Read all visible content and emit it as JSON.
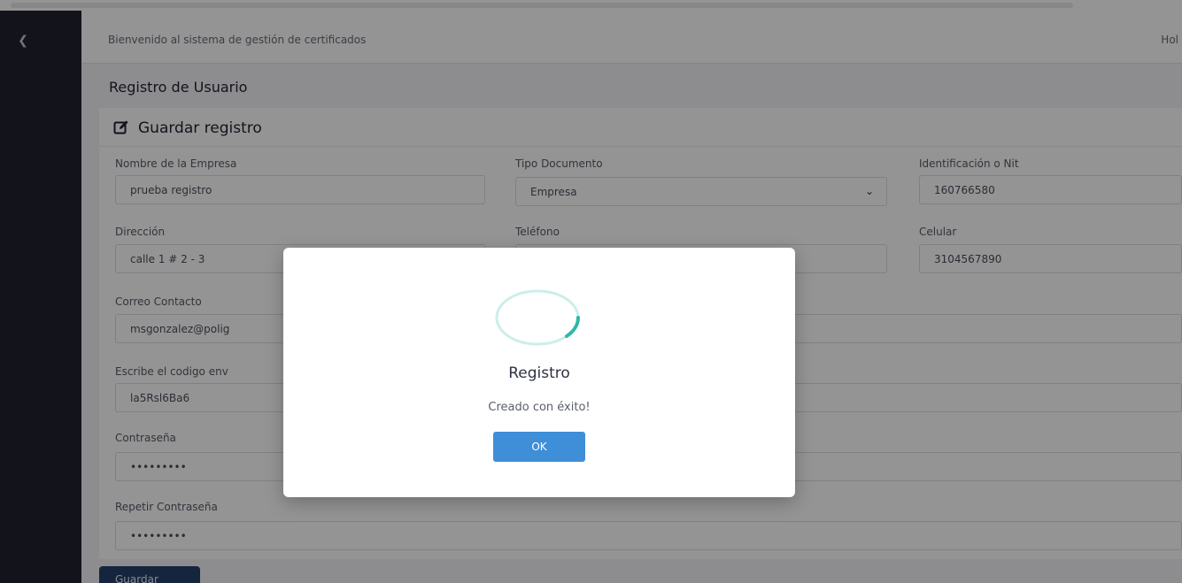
{
  "header": {
    "welcome": "Bienvenido al sistema de gestión de certificados",
    "right_text": "Hol"
  },
  "page": {
    "title": "Registro de Usuario"
  },
  "form": {
    "card_title": "Guardar registro",
    "fields": {
      "empresa": {
        "label": "Nombre de la Empresa",
        "value": "prueba registro"
      },
      "tipo_doc": {
        "label": "Tipo Documento",
        "value": "Empresa"
      },
      "nit": {
        "label": "Identificación o Nit",
        "value": "160766580"
      },
      "direccion": {
        "label": "Dirección",
        "value": "calle 1 # 2 - 3"
      },
      "telefono": {
        "label": "Teléfono",
        "value": ""
      },
      "celular": {
        "label": "Celular",
        "value": "3104567890"
      },
      "correo": {
        "label": "Correo Contacto",
        "value": "msgonzalez@polig"
      },
      "codigo": {
        "label": "Escribe el codigo env",
        "value": "la5Rsl6Ba6"
      },
      "contrasena": {
        "label": "Contraseña",
        "value": "•••••••••"
      },
      "repetir": {
        "label": "Repetir Contraseña",
        "value": "•••••••••"
      }
    },
    "save_label": "Guardar"
  },
  "modal": {
    "title": "Registro",
    "message": "Creado con éxito!",
    "ok_label": "OK"
  },
  "icons": {
    "sidebar_toggle": "chevron-left-icon",
    "card_title": "edit-icon",
    "select": "chevron-down-icon",
    "loader": "spinner-icon"
  },
  "colors": {
    "sidebar": "#1f2230",
    "primary": "#27406b",
    "ok_button": "#3f8ed8",
    "spinner": "#2fb8a6"
  }
}
